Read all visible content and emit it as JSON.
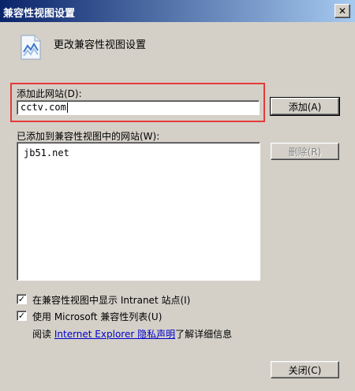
{
  "window": {
    "title": "兼容性视图设置",
    "close_glyph": "✕"
  },
  "header": {
    "title": "更改兼容性视图设置",
    "icon": "compat-view-page-icon"
  },
  "add_site": {
    "label": "添加此网站(D):",
    "value": "cctv.com",
    "add_button": "添加(A)"
  },
  "sites": {
    "label": "已添加到兼容性视图中的网站(W):",
    "items": [
      "jb51.net"
    ],
    "remove_button": "删除(R)"
  },
  "options": [
    {
      "label": "在兼容性视图中显示 Intranet 站点(I)",
      "checked": true
    },
    {
      "label": "使用 Microsoft 兼容性列表(U)",
      "checked": true
    }
  ],
  "privacy": {
    "prefix": "阅读",
    "link": "Internet Explorer 隐私声明",
    "suffix": "了解详细信息"
  },
  "close_button": "关闭(C)",
  "colors": {
    "highlight": "#e53a3a",
    "title_start": "#0a246a",
    "title_end": "#a6caf0"
  }
}
